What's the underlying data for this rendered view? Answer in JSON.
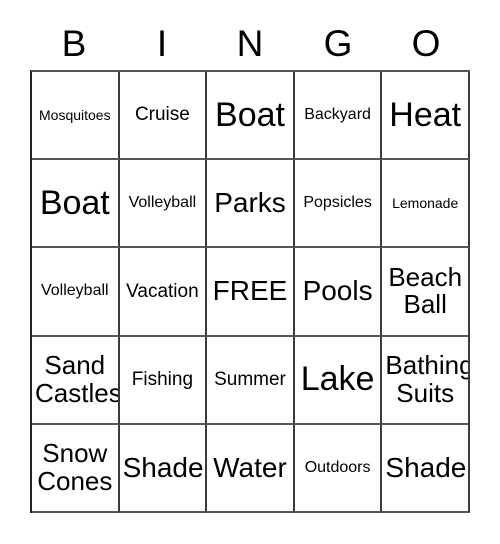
{
  "card": {
    "title_letters": [
      "B",
      "I",
      "N",
      "G",
      "O"
    ],
    "free_space_label": "FREE",
    "colors": {
      "background": "#ffffff",
      "text": "#000000",
      "grid_line": "#3a3a3a"
    },
    "grid": {
      "rows": 5,
      "columns": 5,
      "cells": [
        [
          {
            "label": "Mosquitoes",
            "size": "s-xs",
            "lines": 1
          },
          {
            "label": "Cruise",
            "size": "s-md",
            "lines": 1
          },
          {
            "label": "Boat",
            "size": "s-xxl",
            "lines": 1
          },
          {
            "label": "Backyard",
            "size": "s-sm",
            "lines": 1
          },
          {
            "label": "Heat",
            "size": "s-xxl",
            "lines": 1
          }
        ],
        [
          {
            "label": "Boat",
            "size": "s-xxl",
            "lines": 1
          },
          {
            "label": "Volleyball",
            "size": "s-sm",
            "lines": 1
          },
          {
            "label": "Parks",
            "size": "s-xl",
            "lines": 1
          },
          {
            "label": "Popsicles",
            "size": "s-sm",
            "lines": 1
          },
          {
            "label": "Lemonade",
            "size": "s-xs",
            "lines": 1
          }
        ],
        [
          {
            "label": "Volleyball",
            "size": "s-sm",
            "lines": 1
          },
          {
            "label": "Vacation",
            "size": "s-md",
            "lines": 1
          },
          {
            "label": "FREE",
            "size": "s-xl",
            "lines": 1
          },
          {
            "label": "Pools",
            "size": "s-xl",
            "lines": 1
          },
          {
            "label": "Beach Ball",
            "size": "two-line",
            "lines": 2
          }
        ],
        [
          {
            "label": "Sand Castles",
            "size": "two-line",
            "lines": 2
          },
          {
            "label": "Fishing",
            "size": "s-md",
            "lines": 1
          },
          {
            "label": "Summer",
            "size": "s-md",
            "lines": 1
          },
          {
            "label": "Lake",
            "size": "s-xxl",
            "lines": 1
          },
          {
            "label": "Bathing Suits",
            "size": "two-line",
            "lines": 2
          }
        ],
        [
          {
            "label": "Snow Cones",
            "size": "two-line",
            "lines": 2
          },
          {
            "label": "Shade",
            "size": "s-xl",
            "lines": 1
          },
          {
            "label": "Water",
            "size": "s-xl",
            "lines": 1
          },
          {
            "label": "Outdoors",
            "size": "s-sm",
            "lines": 1
          },
          {
            "label": "Shade",
            "size": "s-xl",
            "lines": 1
          }
        ]
      ]
    }
  }
}
